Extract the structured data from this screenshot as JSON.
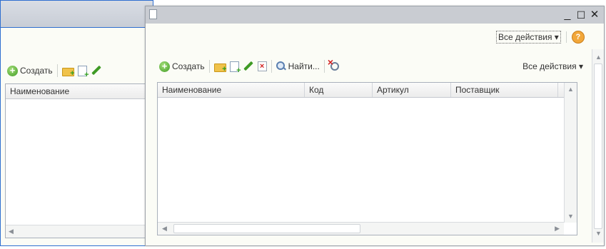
{
  "background_window": {
    "toolbar": {
      "create_label": "Создать",
      "icons": [
        "plus-circle-icon",
        "add-folder-icon",
        "add-copy-icon",
        "edit-pencil-icon"
      ]
    },
    "table": {
      "columns": [
        "Наименование"
      ]
    }
  },
  "front_window": {
    "title": "",
    "controls": {
      "minimize": "_",
      "maximize": "☐",
      "close": "✕"
    },
    "header": {
      "all_actions_label": "Все действия ▾",
      "help_label": "?"
    },
    "toolbar": {
      "create_label": "Создать",
      "find_label": "Найти...",
      "all_actions_label": "Все действия ▾"
    },
    "table": {
      "columns": [
        "Наименование",
        "Код",
        "Артикул",
        "Поставщик"
      ],
      "rows": []
    }
  },
  "colors": {
    "accent_border": "#2f6fd0",
    "titlebar": "#c9ccd2",
    "window_bg": "#fbfcf6"
  }
}
